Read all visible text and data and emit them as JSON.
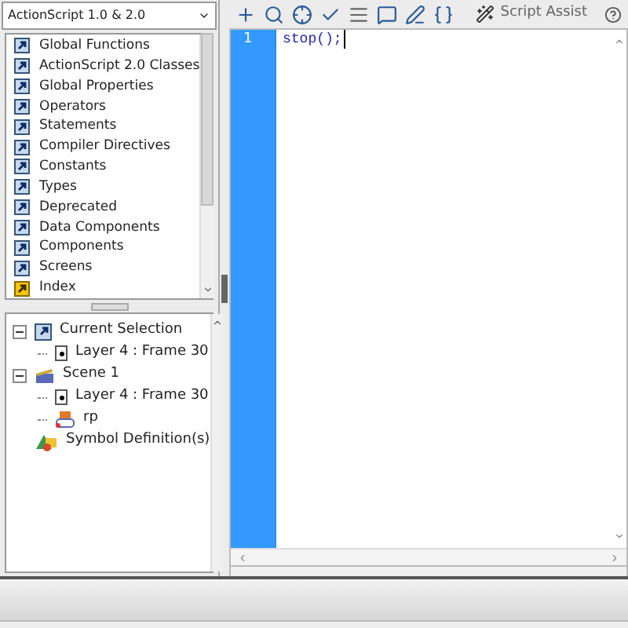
{
  "language_menu": {
    "value": "ActionScript 1.0 & 2.0"
  },
  "categories": [
    {
      "label": "Global Functions",
      "kind": "book"
    },
    {
      "label": "ActionScript 2.0 Classes",
      "kind": "book"
    },
    {
      "label": "Global Properties",
      "kind": "book"
    },
    {
      "label": "Operators",
      "kind": "book"
    },
    {
      "label": "Statements",
      "kind": "book"
    },
    {
      "label": "Compiler Directives",
      "kind": "book"
    },
    {
      "label": "Constants",
      "kind": "book"
    },
    {
      "label": "Types",
      "kind": "book"
    },
    {
      "label": "Deprecated",
      "kind": "book"
    },
    {
      "label": "Data Components",
      "kind": "book"
    },
    {
      "label": "Components",
      "kind": "book"
    },
    {
      "label": "Screens",
      "kind": "book"
    },
    {
      "label": "Index",
      "kind": "index"
    }
  ],
  "toolbar": {
    "script_assist": "Script Assist"
  },
  "editor": {
    "lines": [
      {
        "number": "1",
        "code": "stop();"
      }
    ]
  },
  "script_tree": [
    {
      "label": "Current Selection",
      "kind": "selection",
      "expanded": true,
      "children": [
        {
          "label": "Layer 4 : Frame 30",
          "kind": "frame"
        }
      ]
    },
    {
      "label": "Scene 1",
      "kind": "scene",
      "expanded": true,
      "children": [
        {
          "label": "Layer 4 : Frame 30",
          "kind": "frame"
        },
        {
          "label": "rp",
          "kind": "symbol"
        }
      ]
    },
    {
      "label": "Symbol Definition(s)",
      "kind": "symbols"
    }
  ]
}
